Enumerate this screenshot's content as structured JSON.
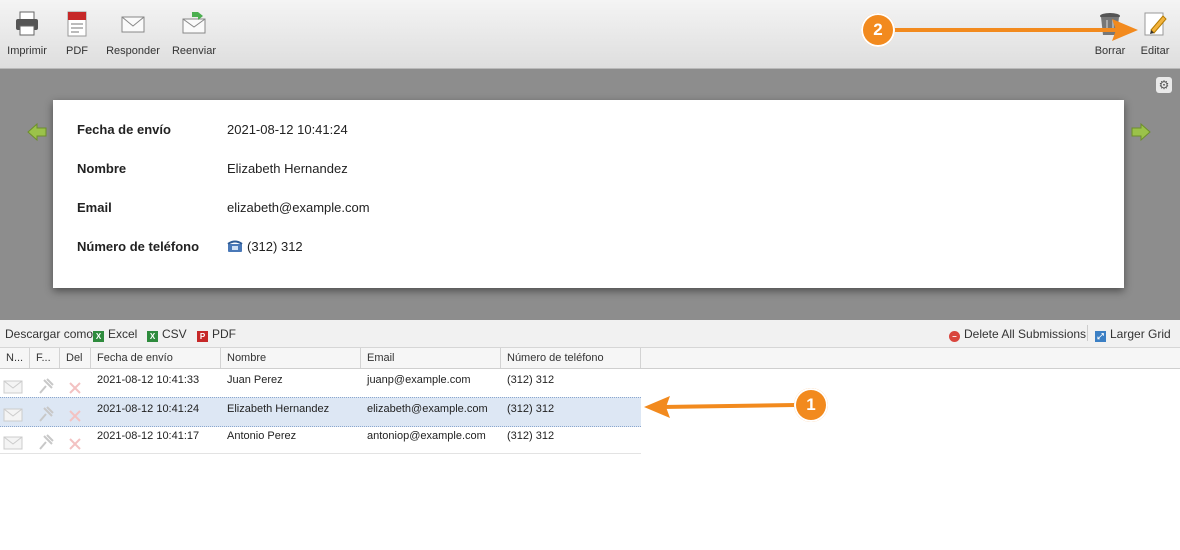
{
  "toolbar": {
    "print_label": "Imprimir",
    "pdf_label": "PDF",
    "reply_label": "Responder",
    "forward_label": "Reenviar",
    "delete_label": "Borrar",
    "edit_label": "Editar"
  },
  "submission": {
    "fields": [
      {
        "label": "Fecha de envío",
        "value": "2021-08-12 10:41:24"
      },
      {
        "label": "Nombre",
        "value": "Elizabeth Hernandez"
      },
      {
        "label": "Email",
        "value": "elizabeth@example.com"
      },
      {
        "label": "Número de teléfono",
        "value": "(312) 312"
      }
    ]
  },
  "download": {
    "label": "Descargar como:",
    "excel": "Excel",
    "csv": "CSV",
    "pdf": "PDF",
    "delete_all": "Delete All Submissions",
    "larger_grid": "Larger Grid"
  },
  "grid": {
    "headers": [
      "N...",
      "F...",
      "Del",
      "Fecha de envío",
      "Nombre",
      "Email",
      "Número de teléfono"
    ],
    "rows": [
      {
        "date": "2021-08-12 10:41:33",
        "name": "Juan Perez",
        "email": "juanp@example.com",
        "phone": "(312) 312"
      },
      {
        "date": "2021-08-12 10:41:24",
        "name": "Elizabeth Hernandez",
        "email": "elizabeth@example.com",
        "phone": "(312) 312"
      },
      {
        "date": "2021-08-12 10:41:17",
        "name": "Antonio Perez",
        "email": "antoniop@example.com",
        "phone": "(312) 312"
      }
    ],
    "selected_row": 1
  },
  "callouts": {
    "one": "1",
    "two": "2"
  },
  "colors": {
    "accent": "#f28a1e",
    "selected_row": "#dde7f4"
  }
}
